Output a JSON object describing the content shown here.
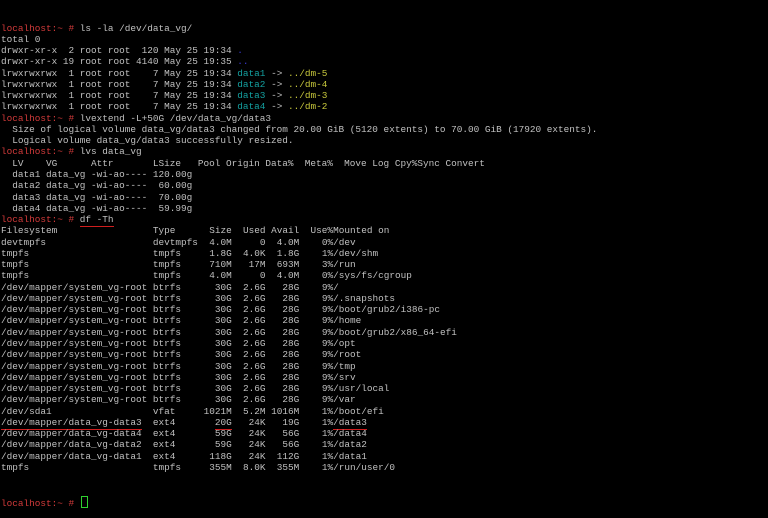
{
  "prompt": "localhost:~ # ",
  "colors": {
    "prompt": "#d23a3a",
    "text": "#c0c0c0",
    "link": "#14a0a0",
    "target": "#c8c83c",
    "dir": "#3b3bd8",
    "cursor": "#2fd12f",
    "annotation": "#d01e1e"
  },
  "block1": [
    [
      {
        "t": "localhost:~ # ",
        "c": "prompt"
      },
      {
        "t": "ls -la /dev/data_vg/"
      }
    ],
    [
      {
        "t": "total 0"
      }
    ],
    [
      {
        "t": "drwxr-xr-x  2 root root  120 May 25 19:34 "
      },
      {
        "t": ".",
        "c": "blue"
      }
    ],
    [
      {
        "t": "drwxr-xr-x 19 root root 4140 May 25 19:35 "
      },
      {
        "t": "..",
        "c": "blue"
      }
    ],
    [
      {
        "t": "lrwxrwxrwx  1 root root    7 May 25 19:34 "
      },
      {
        "t": "data1",
        "c": "cyan"
      },
      {
        "t": " -> "
      },
      {
        "t": "../dm-5",
        "c": "yellow"
      }
    ],
    [
      {
        "t": "lrwxrwxrwx  1 root root    7 May 25 19:34 "
      },
      {
        "t": "data2",
        "c": "cyan"
      },
      {
        "t": " -> "
      },
      {
        "t": "../dm-4",
        "c": "yellow"
      }
    ],
    [
      {
        "t": "lrwxrwxrwx  1 root root    7 May 25 19:34 "
      },
      {
        "t": "data3",
        "c": "cyan"
      },
      {
        "t": " -> "
      },
      {
        "t": "../dm-3",
        "c": "yellow"
      }
    ],
    [
      {
        "t": "lrwxrwxrwx  1 root root    7 May 25 19:34 "
      },
      {
        "t": "data4",
        "c": "cyan"
      },
      {
        "t": " -> "
      },
      {
        "t": "../dm-2",
        "c": "yellow"
      }
    ],
    [
      {
        "t": "localhost:~ # ",
        "c": "prompt"
      },
      {
        "t": "lvextend -L+50G /dev/data_vg/data3"
      }
    ],
    [
      {
        "t": "  Size of logical volume data_vg/data3 changed from 20.00 GiB (5120 extents) to 70.00 GiB (17920 extents)."
      }
    ],
    [
      {
        "t": "  Logical volume data_vg/data3 successfully resized."
      }
    ],
    [
      {
        "t": "localhost:~ # ",
        "c": "prompt"
      },
      {
        "t": "lvs data_vg"
      }
    ],
    [
      {
        "t": "  LV    VG      Attr       LSize   Pool Origin Data%  Meta%  Move Log Cpy%Sync Convert"
      }
    ],
    [
      {
        "t": "  data1 data_vg -wi-ao---- 120.00g"
      }
    ],
    [
      {
        "t": "  data2 data_vg -wi-ao----  60.00g"
      }
    ],
    [
      {
        "t": "  data3 data_vg -wi-ao----  70.00g"
      }
    ],
    [
      {
        "t": "  data4 data_vg -wi-ao----  59.99g"
      }
    ],
    [
      {
        "t": "localhost:~ # ",
        "c": "prompt"
      },
      {
        "t": "df -Th",
        "c": "mark"
      }
    ]
  ],
  "df": {
    "header": [
      "Filesystem",
      "Type",
      "Size",
      "Used",
      "Avail",
      "Use%",
      "Mounted on"
    ],
    "rows": [
      [
        "devtmpfs",
        "devtmpfs",
        "4.0M",
        "0",
        "4.0M",
        "0%",
        "/dev"
      ],
      [
        "tmpfs",
        "tmpfs",
        "1.8G",
        "4.0K",
        "1.8G",
        "1%",
        "/dev/shm"
      ],
      [
        "tmpfs",
        "tmpfs",
        "710M",
        "17M",
        "693M",
        "3%",
        "/run"
      ],
      [
        "tmpfs",
        "tmpfs",
        "4.0M",
        "0",
        "4.0M",
        "0%",
        "/sys/fs/cgroup"
      ],
      [
        "/dev/mapper/system_vg-root",
        "btrfs",
        "30G",
        "2.6G",
        "28G",
        "9%",
        "/"
      ],
      [
        "/dev/mapper/system_vg-root",
        "btrfs",
        "30G",
        "2.6G",
        "28G",
        "9%",
        "/.snapshots"
      ],
      [
        "/dev/mapper/system_vg-root",
        "btrfs",
        "30G",
        "2.6G",
        "28G",
        "9%",
        "/boot/grub2/i386-pc"
      ],
      [
        "/dev/mapper/system_vg-root",
        "btrfs",
        "30G",
        "2.6G",
        "28G",
        "9%",
        "/home"
      ],
      [
        "/dev/mapper/system_vg-root",
        "btrfs",
        "30G",
        "2.6G",
        "28G",
        "9%",
        "/boot/grub2/x86_64-efi"
      ],
      [
        "/dev/mapper/system_vg-root",
        "btrfs",
        "30G",
        "2.6G",
        "28G",
        "9%",
        "/opt"
      ],
      [
        "/dev/mapper/system_vg-root",
        "btrfs",
        "30G",
        "2.6G",
        "28G",
        "9%",
        "/root"
      ],
      [
        "/dev/mapper/system_vg-root",
        "btrfs",
        "30G",
        "2.6G",
        "28G",
        "9%",
        "/tmp"
      ],
      [
        "/dev/mapper/system_vg-root",
        "btrfs",
        "30G",
        "2.6G",
        "28G",
        "9%",
        "/srv"
      ],
      [
        "/dev/mapper/system_vg-root",
        "btrfs",
        "30G",
        "2.6G",
        "28G",
        "9%",
        "/usr/local"
      ],
      [
        "/dev/mapper/system_vg-root",
        "btrfs",
        "30G",
        "2.6G",
        "28G",
        "9%",
        "/var"
      ],
      [
        "/dev/sda1",
        "vfat",
        "1021M",
        "5.2M",
        "1016M",
        "1%",
        "/boot/efi"
      ],
      [
        "/dev/mapper/data_vg-data3",
        "ext4",
        "20G",
        "24K",
        "19G",
        "1%",
        "/data3"
      ],
      [
        "/dev/mapper/data_vg-data4",
        "ext4",
        "59G",
        "24K",
        "56G",
        "1%",
        "/data4"
      ],
      [
        "/dev/mapper/data_vg-data2",
        "ext4",
        "59G",
        "24K",
        "56G",
        "1%",
        "/data2"
      ],
      [
        "/dev/mapper/data_vg-data1",
        "ext4",
        "118G",
        "24K",
        "112G",
        "1%",
        "/data1"
      ],
      [
        "tmpfs",
        "tmpfs",
        "355M",
        "8.0K",
        "355M",
        "1%",
        "/run/user/0"
      ]
    ],
    "annotated_row": 16,
    "annotated_cols": [
      0,
      2,
      6
    ]
  }
}
